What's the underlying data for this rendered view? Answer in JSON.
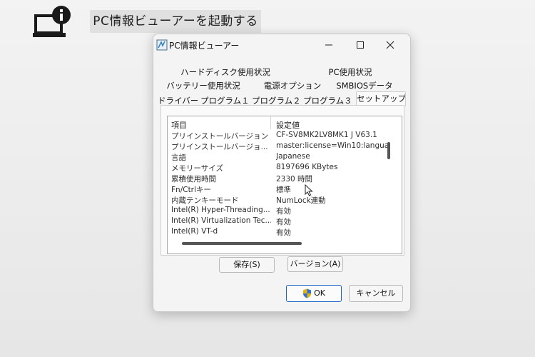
{
  "background": {
    "caption": "PC情報ビューアーを起動する",
    "icon": "laptop-info-icon"
  },
  "window": {
    "title": "PC情報ビューアー",
    "app_icon": "pc-info-viewer-icon",
    "controls": {
      "minimize": "minimize-icon",
      "maximize": "maximize-icon",
      "close": "close-icon"
    }
  },
  "tabs": {
    "row1": [
      {
        "label": "ハードディスク使用状況"
      },
      {
        "label": "PC使用状況"
      }
    ],
    "row2": [
      {
        "label": "バッテリー使用状況"
      },
      {
        "label": "電源オプション"
      },
      {
        "label": "SMBIOSデータ"
      }
    ],
    "row3": [
      {
        "label": "ドライバー"
      },
      {
        "label": "プログラム１"
      },
      {
        "label": "プログラム２"
      },
      {
        "label": "プログラム３"
      },
      {
        "label": "セットアップ",
        "active": true
      }
    ]
  },
  "listview": {
    "columns": [
      "項目",
      "設定値"
    ],
    "rows": [
      {
        "name": "プリインストールバージョン",
        "value": "CF-SV8MK2LV8MK1  J V63.1"
      },
      {
        "name": "プリインストールバージョ...",
        "value": "master:license=Win10:languag"
      },
      {
        "name": "言語",
        "value": "Japanese"
      },
      {
        "name": "メモリーサイズ",
        "value": "8197696 KBytes"
      },
      {
        "name": "累積使用時間",
        "value": "2330 時間"
      },
      {
        "name": "Fn/Ctrlキー",
        "value": "標準"
      },
      {
        "name": "内蔵テンキーモード",
        "value": "NumLock連動"
      },
      {
        "name": "Intel(R) Hyper-Threading...",
        "value": "有効"
      },
      {
        "name": "Intel(R) Virtualization Tec...",
        "value": "有効"
      },
      {
        "name": "Intel(R) VT-d",
        "value": "有効"
      }
    ]
  },
  "buttons": {
    "save": "保存(S)",
    "version": "バージョン(A)",
    "ok": "OK",
    "cancel": "キャンセル"
  },
  "colors": {
    "ok_border": "#1a62c4",
    "window_bg": "#f4f4f4"
  }
}
